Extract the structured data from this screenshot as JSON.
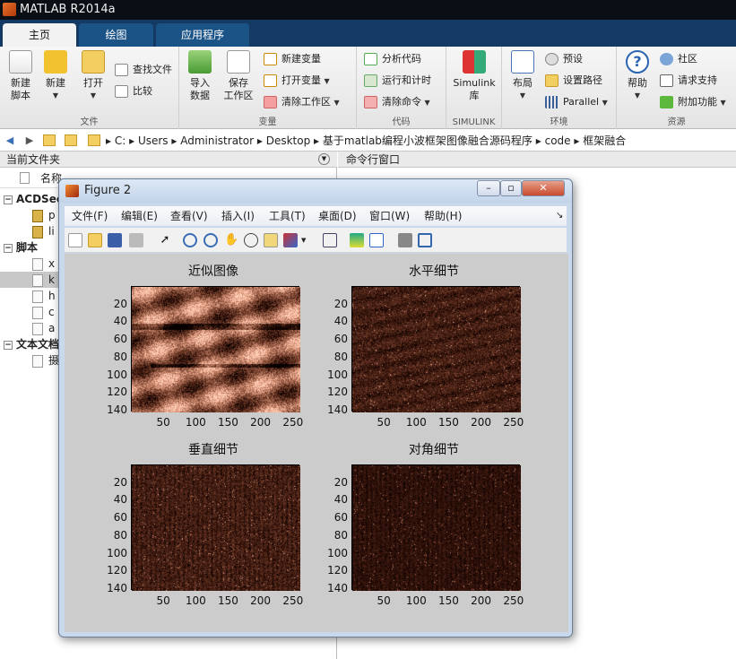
{
  "app": {
    "title": "MATLAB R2014a"
  },
  "tabs": [
    "主页",
    "绘图",
    "应用程序"
  ],
  "ribbon": {
    "file": {
      "label": "文件",
      "new_script": "新建\n脚本",
      "new": "新建",
      "open": "打开",
      "find_files": "查找文件",
      "compare": "比较"
    },
    "variable": {
      "label": "变量",
      "import": "导入\n数据",
      "save_ws": "保存\n工作区",
      "new_var": "新建变量",
      "open_var": "打开变量",
      "clear_ws": "清除工作区"
    },
    "code": {
      "label": "代码",
      "analyze": "分析代码",
      "run_time": "运行和计时",
      "clear_cmd": "清除命令"
    },
    "simulink": {
      "label": "SIMULINK",
      "lib": "Simulink\n库"
    },
    "env": {
      "label": "环境",
      "layout": "布局",
      "prefs": "预设",
      "set_path": "设置路径",
      "parallel": "Parallel"
    },
    "resources": {
      "label": "资源",
      "help": "帮助",
      "community": "社区",
      "support": "请求支持",
      "addons": "附加功能"
    }
  },
  "address": {
    "crumbs": [
      "C:",
      "Users",
      "Administrator",
      "Desktop",
      "基于matlab编程小波框架图像融合源码程序",
      "code",
      "框架融合"
    ]
  },
  "current_folder": {
    "title": "当前文件夹",
    "col_name": "名称",
    "groups": [
      {
        "name": "ACDSee",
        "items": [
          "p",
          "li"
        ]
      },
      {
        "name": "脚本",
        "items": [
          "x",
          "k",
          "h",
          "c",
          "a"
        ]
      },
      {
        "name": "文本文档",
        "items": [
          "摄"
        ]
      }
    ]
  },
  "command_window": {
    "title": "命令行窗口"
  },
  "figure": {
    "title": "Figure 2",
    "menu": [
      "文件(F)",
      "编辑(E)",
      "查看(V)",
      "插入(I)",
      "工具(T)",
      "桌面(D)",
      "窗口(W)",
      "帮助(H)"
    ],
    "subplots": [
      {
        "title": "近似图像",
        "style": "approx"
      },
      {
        "title": "水平细节",
        "style": "detail"
      },
      {
        "title": "垂直细节",
        "style": "detail"
      },
      {
        "title": "对角细节",
        "style": "detail"
      }
    ],
    "yticks": [
      "20",
      "40",
      "60",
      "80",
      "100",
      "120",
      "140"
    ],
    "xticks": [
      "50",
      "100",
      "150",
      "200",
      "250"
    ]
  }
}
